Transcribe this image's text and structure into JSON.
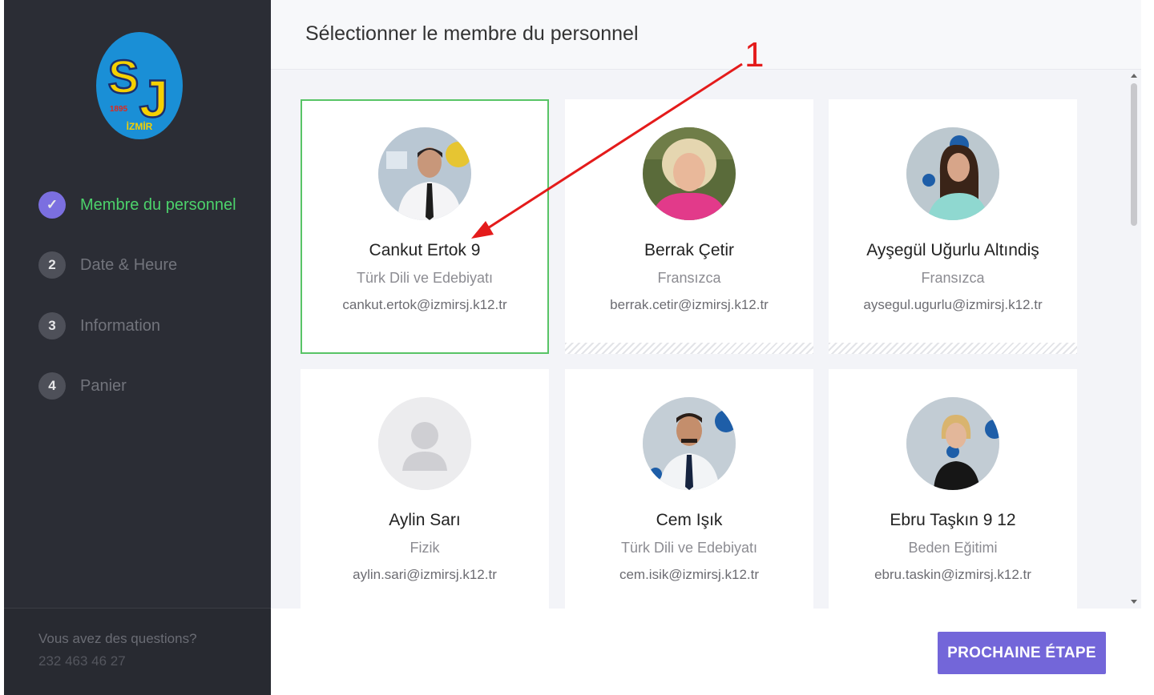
{
  "sidebar": {
    "logo": {
      "letters": "SJ",
      "year": "1895",
      "city": "İZMİR",
      "colors": {
        "circle": "#1a8fd6",
        "letters": "#f5d000",
        "year": "#e0281c"
      }
    },
    "steps": [
      {
        "number": "✓",
        "label": "Membre du personnel",
        "state": "completed"
      },
      {
        "number": "2",
        "label": "Date & Heure",
        "state": "pending"
      },
      {
        "number": "3",
        "label": "Information",
        "state": "pending"
      },
      {
        "number": "4",
        "label": "Panier",
        "state": "pending"
      }
    ],
    "footer": {
      "question": "Vous avez des questions?",
      "phone": "232 463 46 27"
    }
  },
  "header": {
    "title": "Sélectionner le membre du personnel"
  },
  "staff": [
    {
      "name": "Cankut Ertok 9",
      "subject": "Türk Dili ve Edebiyatı",
      "email": "cankut.ertok@izmirsj.k12.tr",
      "selected": true,
      "avatar": "photo-man-white-shirt-dark-tie"
    },
    {
      "name": "Berrak Çetir",
      "subject": "Fransızca",
      "email": "berrak.cetir@izmirsj.k12.tr",
      "selected": false,
      "avatar": "photo-woman-blonde-pink-scarf"
    },
    {
      "name": "Ayşegül Uğurlu Altındiş",
      "subject": "Fransızca",
      "email": "aysegul.ugurlu@izmirsj.k12.tr",
      "selected": false,
      "avatar": "photo-woman-dark-hair-teal-top"
    },
    {
      "name": "Aylin Sarı",
      "subject": "Fizik",
      "email": "aylin.sari@izmirsj.k12.tr",
      "selected": false,
      "avatar": "default-user-placeholder"
    },
    {
      "name": "Cem Işık",
      "subject": "Türk Dili ve Edebiyatı",
      "email": "cem.isik@izmirsj.k12.tr",
      "selected": false,
      "avatar": "photo-man-mustache-white-shirt-tie"
    },
    {
      "name": "Ebru Taşkın 9 12",
      "subject": "Beden Eğitimi",
      "email": "ebru.taskin@izmirsj.k12.tr",
      "selected": false,
      "avatar": "photo-woman-blonde-black-top"
    }
  ],
  "footer": {
    "next_label": "PROCHAINE ÉTAPE"
  },
  "annotation": {
    "label": "1",
    "color": "#e41b1b"
  },
  "colors": {
    "sidebar_bg": "#2b2d35",
    "accent": "#7366d9",
    "completed": "#4cd26b",
    "selected_border": "#58c466"
  }
}
